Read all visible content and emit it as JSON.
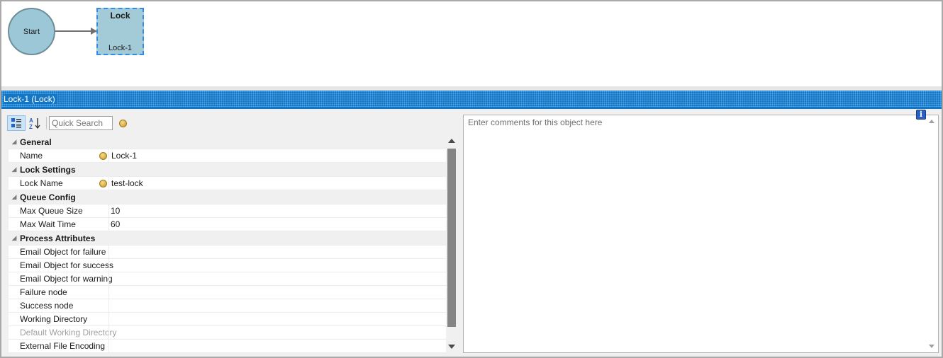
{
  "diagram": {
    "start_node": {
      "label": "Start"
    },
    "lock_node": {
      "title": "Lock",
      "subtitle": "Lock-1"
    }
  },
  "panel": {
    "title": "Lock-1 (Lock)",
    "search_placeholder": "Quick Search",
    "comments_placeholder": "Enter comments for this object here",
    "info_icon": "i"
  },
  "properties": {
    "general": {
      "label": "General",
      "rows": [
        {
          "name": "Name",
          "value": "Lock-1"
        }
      ]
    },
    "lock_settings": {
      "label": "Lock Settings",
      "rows": [
        {
          "name": "Lock Name",
          "value": "test-lock"
        }
      ]
    },
    "queue_config": {
      "label": "Queue Config",
      "rows": [
        {
          "name": "Max Queue Size",
          "value": "10"
        },
        {
          "name": "Max Wait Time",
          "value": "60"
        }
      ]
    },
    "process_attributes": {
      "label": "Process Attributes",
      "rows": [
        {
          "name": "Email Object for failure",
          "value": ""
        },
        {
          "name": "Email Object for success",
          "value": ""
        },
        {
          "name": "Email Object for warning",
          "value": ""
        },
        {
          "name": "Failure node",
          "value": ""
        },
        {
          "name": "Success node",
          "value": ""
        },
        {
          "name": "Working Directory",
          "value": ""
        },
        {
          "name": "Default Working Directory",
          "value": ""
        },
        {
          "name": "External File Encoding",
          "value": ""
        }
      ]
    }
  },
  "colors": {
    "header_blue": "#1477c6",
    "node_fill": "#a3cad7",
    "selection_dash": "#2f8ce8"
  }
}
